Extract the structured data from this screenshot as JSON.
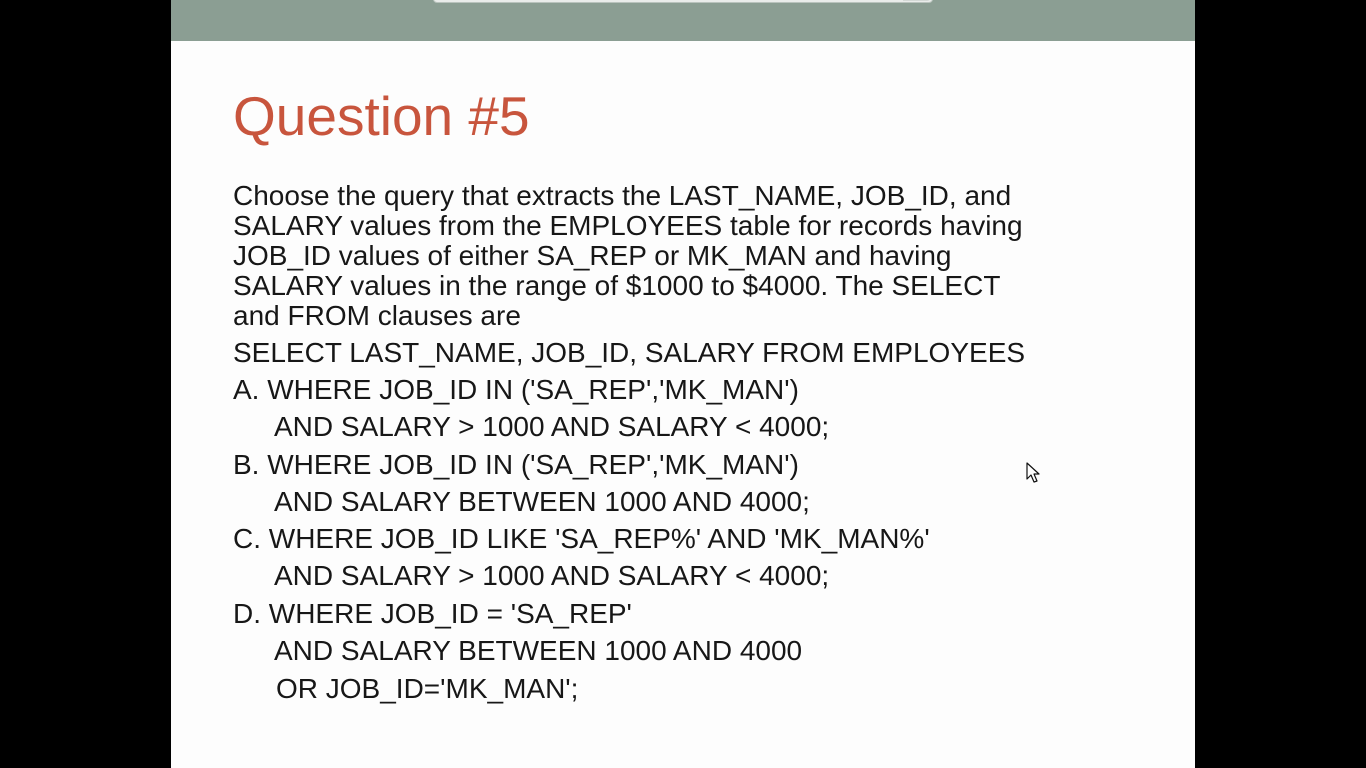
{
  "slide": {
    "title": "Question #5",
    "prompt_lines": [
      "Choose the query that extracts the LAST_NAME, JOB_ID, and",
      "SALARY values from the EMPLOYEES table for records having",
      "JOB_ID values of either SA_REP or MK_MAN and having",
      "SALARY values in the range of $1000 to $4000. The SELECT",
      "and FROM clauses are"
    ],
    "select_line": "SELECT LAST_NAME, JOB_ID, SALARY FROM EMPLOYEES",
    "options": [
      {
        "line1": "A. WHERE JOB_ID IN ('SA_REP','MK_MAN')",
        "line2": "AND SALARY > 1000 AND SALARY < 4000;"
      },
      {
        "line1": "B. WHERE JOB_ID IN ('SA_REP','MK_MAN')",
        "line2": "AND SALARY BETWEEN 1000 AND 4000;"
      },
      {
        "line1": "C. WHERE JOB_ID LIKE 'SA_REP%' AND 'MK_MAN%'",
        "line2": "AND SALARY > 1000 AND SALARY < 4000;"
      },
      {
        "line1": "D. WHERE JOB_ID = 'SA_REP'",
        "line2": "AND SALARY BETWEEN 1000 AND 4000",
        "line3": "OR JOB_ID='MK_MAN';"
      }
    ]
  },
  "colors": {
    "title": "#c8553d",
    "body_text": "#171717",
    "top_band": "#8b9e93",
    "slide_background": "#fdfdfd",
    "letterbox": "#000000"
  },
  "icons": {
    "cursor": "mouse-pointer-icon"
  }
}
